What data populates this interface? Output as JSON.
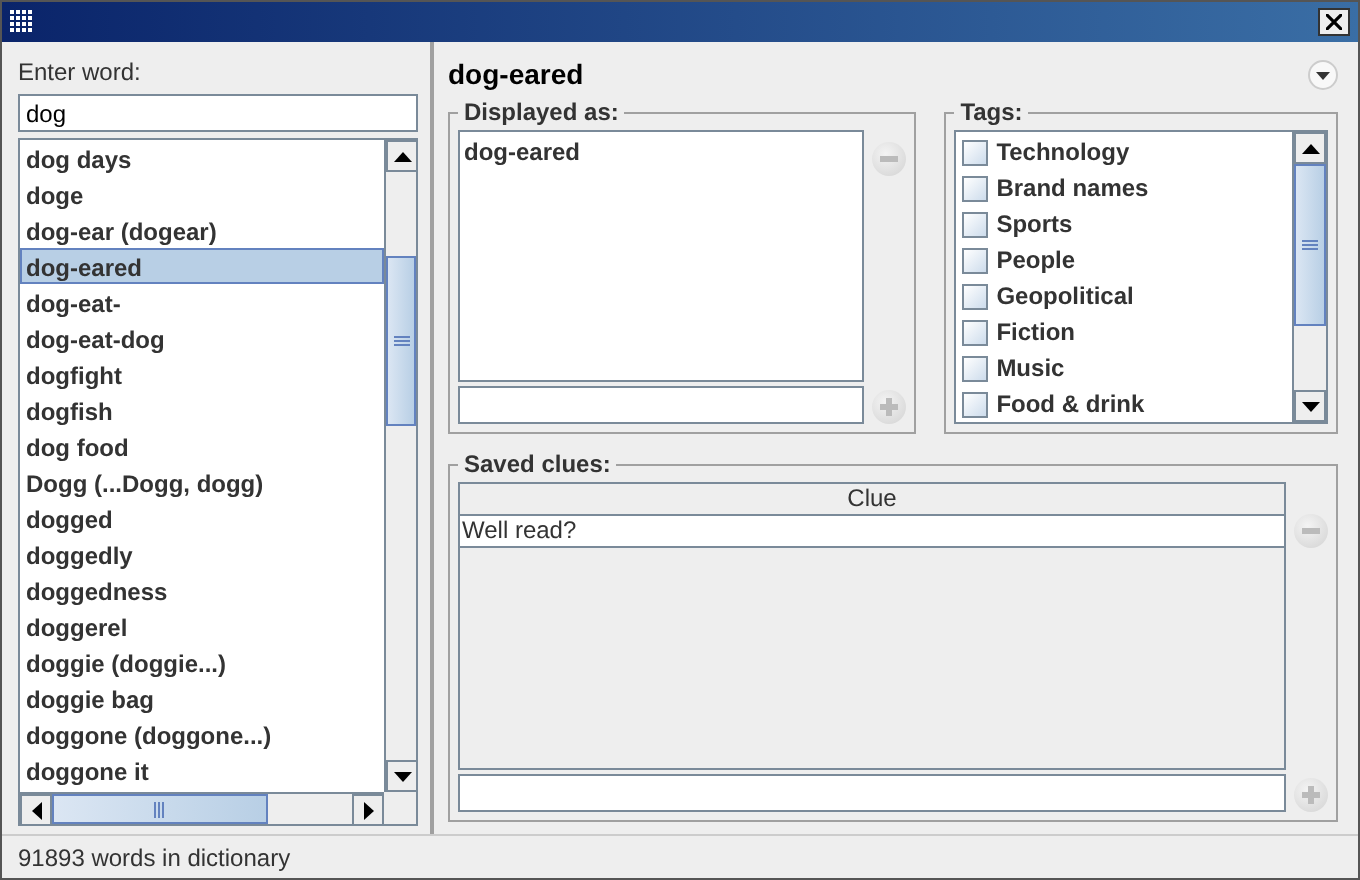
{
  "search": {
    "label": "Enter word:",
    "value": "dog"
  },
  "words": [
    {
      "text": "dog days",
      "selected": false
    },
    {
      "text": "doge",
      "selected": false
    },
    {
      "text": "dog-ear (dogear)",
      "selected": false
    },
    {
      "text": "dog-eared",
      "selected": true
    },
    {
      "text": "dog-eat-",
      "selected": false
    },
    {
      "text": "dog-eat-dog",
      "selected": false
    },
    {
      "text": "dogfight",
      "selected": false
    },
    {
      "text": "dogfish",
      "selected": false
    },
    {
      "text": "dog food",
      "selected": false
    },
    {
      "text": "Dogg (...Dogg, dogg)",
      "selected": false
    },
    {
      "text": "dogged",
      "selected": false
    },
    {
      "text": "doggedly",
      "selected": false
    },
    {
      "text": "doggedness",
      "selected": false
    },
    {
      "text": "doggerel",
      "selected": false
    },
    {
      "text": "doggie (doggie...)",
      "selected": false
    },
    {
      "text": "doggie bag",
      "selected": false
    },
    {
      "text": "doggone (doggone...)",
      "selected": false
    },
    {
      "text": "doggone it",
      "selected": false
    }
  ],
  "detail": {
    "heading": "dog-eared",
    "displayed_as": {
      "legend": "Displayed as:",
      "items": [
        "dog-eared"
      ]
    },
    "tags": {
      "legend": "Tags:",
      "items": [
        {
          "label": "Technology",
          "checked": false
        },
        {
          "label": "Brand names",
          "checked": false
        },
        {
          "label": "Sports",
          "checked": false
        },
        {
          "label": "People",
          "checked": false
        },
        {
          "label": "Geopolitical",
          "checked": false
        },
        {
          "label": "Fiction",
          "checked": false
        },
        {
          "label": "Music",
          "checked": false
        },
        {
          "label": "Food & drink",
          "checked": false
        }
      ]
    },
    "saved_clues": {
      "legend": "Saved clues:",
      "column": "Clue",
      "rows": [
        "Well read?"
      ]
    }
  },
  "status_bar": "91893 words in dictionary"
}
